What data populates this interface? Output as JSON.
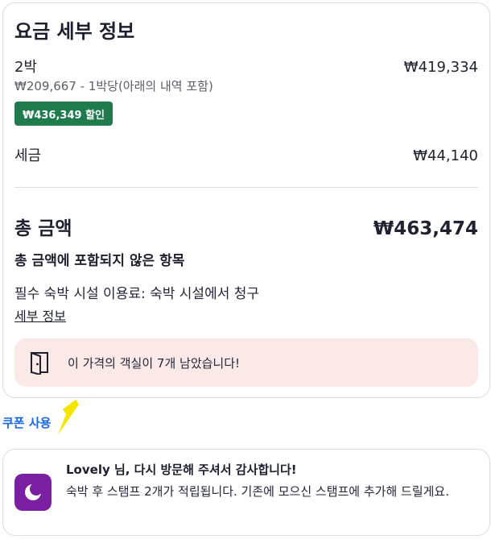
{
  "price_details": {
    "title": "요금 세부 정보",
    "nights_label": "2박",
    "nights_price": "₩419,334",
    "per_night_note": "₩209,667 - 1박당(아래의 내역 포함)",
    "discount_badge": "₩436,349 할인",
    "taxes_label": "세금",
    "taxes_price": "₩44,140",
    "total_label": "총 금액",
    "total_price": "₩463,474",
    "excluded_title": "총 금액에 포함되지 않은 항목",
    "mandatory_fee": "필수 숙박 시설 이용료: 숙박 시설에서 청구",
    "details_link": "세부 정보",
    "scarcity_message": "이 가격의 객실이 7개 남았습니다!",
    "scarcity_icon": "door-icon"
  },
  "coupon": {
    "link_label": "쿠폰 사용"
  },
  "loyalty": {
    "icon": "moon-icon",
    "headline": "Lovely 님, 다시 방문해 주셔서 감사합니다!",
    "body": "숙박 후 스탬프 2개가 적립됩니다. 기존에 모으신 스탬프에 추가해 드릴게요."
  },
  "colors": {
    "discount_badge_bg": "#1f7a4c",
    "scarcity_bg": "#fbe9e7",
    "link_blue": "#1668e3",
    "loyalty_icon_bg": "#7b1fa2",
    "marker_yellow": "#f5e600"
  }
}
